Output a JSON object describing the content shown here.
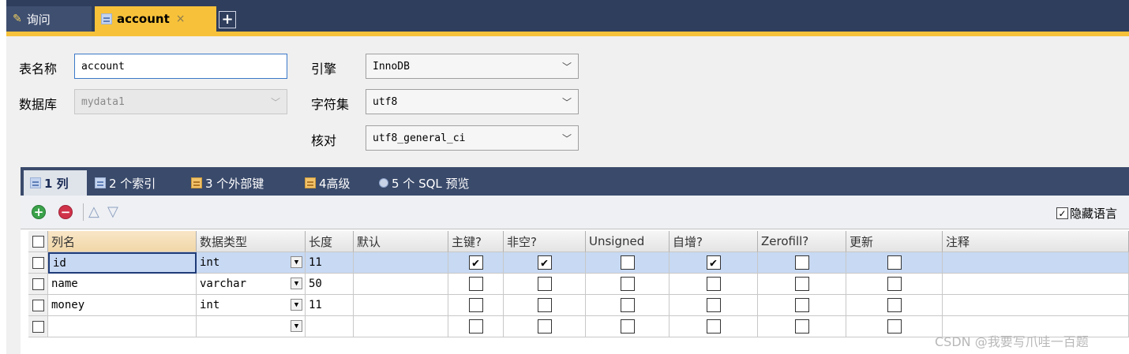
{
  "tabs": {
    "query_label": "询问",
    "account_label": "account",
    "close_glyph": "×",
    "add_glyph": "+"
  },
  "form": {
    "table_name_label": "表名称",
    "table_name_value": "account",
    "database_label": "数据库",
    "database_value": "mydata1",
    "engine_label": "引擎",
    "engine_value": "InnoDB",
    "charset_label": "字符集",
    "charset_value": "utf8",
    "collation_label": "核对",
    "collation_value": "utf8_general_ci"
  },
  "subtabs": [
    {
      "label": "1 列"
    },
    {
      "label": "2 个索引"
    },
    {
      "label": "3 个外部键"
    },
    {
      "label": "4高级"
    },
    {
      "label": "5 个 SQL 预览"
    }
  ],
  "toolbar": {
    "hide_lang_label": "隐藏语言",
    "hide_lang_checked": true
  },
  "grid": {
    "headers": [
      "列名",
      "数据类型",
      "长度",
      "默认",
      "主键?",
      "非空?",
      "Unsigned",
      "自增?",
      "Zerofill?",
      "更新",
      "注释"
    ],
    "rows": [
      {
        "name": "id",
        "type": "int",
        "length": "11",
        "default": "",
        "pk": "✔",
        "notnull": "✔",
        "unsigned": "",
        "ai": "✔",
        "zerofill": "",
        "update": "",
        "comment": ""
      },
      {
        "name": "name",
        "type": "varchar",
        "length": "50",
        "default": "",
        "pk": "",
        "notnull": "",
        "unsigned": "",
        "ai": "",
        "zerofill": "",
        "update": "",
        "comment": ""
      },
      {
        "name": "money",
        "type": "int",
        "length": "11",
        "default": "",
        "pk": "",
        "notnull": "",
        "unsigned": "",
        "ai": "",
        "zerofill": "",
        "update": "",
        "comment": ""
      },
      {
        "name": "",
        "type": "",
        "length": "",
        "default": "",
        "pk": "",
        "notnull": "",
        "unsigned": "",
        "ai": "",
        "zerofill": "",
        "update": "",
        "comment": ""
      }
    ]
  },
  "watermark": "CSDN @我要写爪哇一百题"
}
